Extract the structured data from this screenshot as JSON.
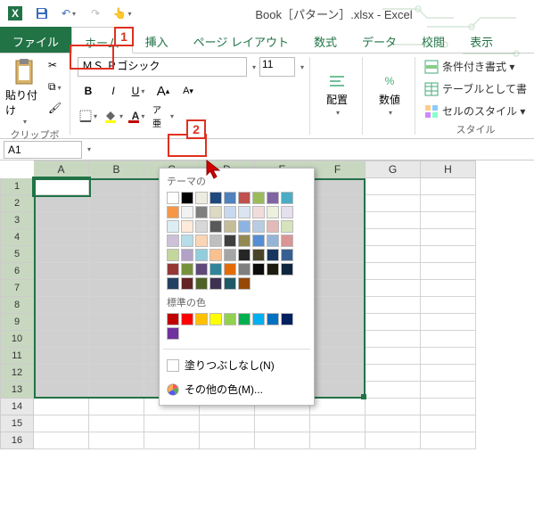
{
  "title": "Book［パターン］.xlsx - Excel",
  "tabs": {
    "file": "ファイル",
    "home": "ホーム",
    "insert": "挿入",
    "layout": "ページ レイアウト",
    "formula": "数式",
    "data": "データ",
    "review": "校閲",
    "view": "表示"
  },
  "font": {
    "name": "ＭＳ Ｐゴシック",
    "size": "11"
  },
  "groups": {
    "clipboard": "クリップボード",
    "paste": "貼り付け",
    "align": "配置",
    "number": "数値",
    "style": "スタイル"
  },
  "styles": {
    "cond": "条件付き書式 ▾",
    "table": "テーブルとして書",
    "cell": "セルのスタイル ▾"
  },
  "namebox": "A1",
  "columns": [
    "A",
    "B",
    "C",
    "D",
    "E",
    "F",
    "G",
    "H"
  ],
  "rows": [
    "1",
    "2",
    "3",
    "4",
    "5",
    "6",
    "7",
    "8",
    "9",
    "10",
    "11",
    "12",
    "13",
    "14",
    "15",
    "16"
  ],
  "colormenu": {
    "theme": "テーマの",
    "std": "標準の色",
    "nofill": "塗りつぶしなし(N)",
    "more": "その他の色(M)..."
  },
  "theme_colors": [
    "#ffffff",
    "#000000",
    "#eeece1",
    "#1f497d",
    "#4f81bd",
    "#c0504d",
    "#9bbb59",
    "#8064a2",
    "#4bacc6",
    "#f79646",
    "#f2f2f2",
    "#7f7f7f",
    "#ddd9c3",
    "#c6d9f0",
    "#dbe5f1",
    "#f2dcdb",
    "#ebf1dd",
    "#e5e0ec",
    "#dbeef3",
    "#fdeada",
    "#d8d8d8",
    "#595959",
    "#c4bd97",
    "#8db3e2",
    "#b8cce4",
    "#e5b9b7",
    "#d7e3bc",
    "#ccc1d9",
    "#b7dde8",
    "#fbd5b5",
    "#bfbfbf",
    "#3f3f3f",
    "#938953",
    "#548dd4",
    "#95b3d7",
    "#d99694",
    "#c3d69b",
    "#b2a2c7",
    "#92cddc",
    "#fac08f",
    "#a5a5a5",
    "#262626",
    "#494429",
    "#17365d",
    "#366092",
    "#953734",
    "#76923c",
    "#5f497a",
    "#31859b",
    "#e36c09",
    "#7f7f7f",
    "#0c0c0c",
    "#1d1b10",
    "#0f243e",
    "#244061",
    "#632423",
    "#4f6128",
    "#3f3151",
    "#205867",
    "#974806"
  ],
  "std_colors": [
    "#c00000",
    "#ff0000",
    "#ffc000",
    "#ffff00",
    "#92d050",
    "#00b050",
    "#00b0f0",
    "#0070c0",
    "#002060",
    "#7030a0"
  ],
  "callouts": {
    "c1": "1",
    "c2": "2"
  }
}
